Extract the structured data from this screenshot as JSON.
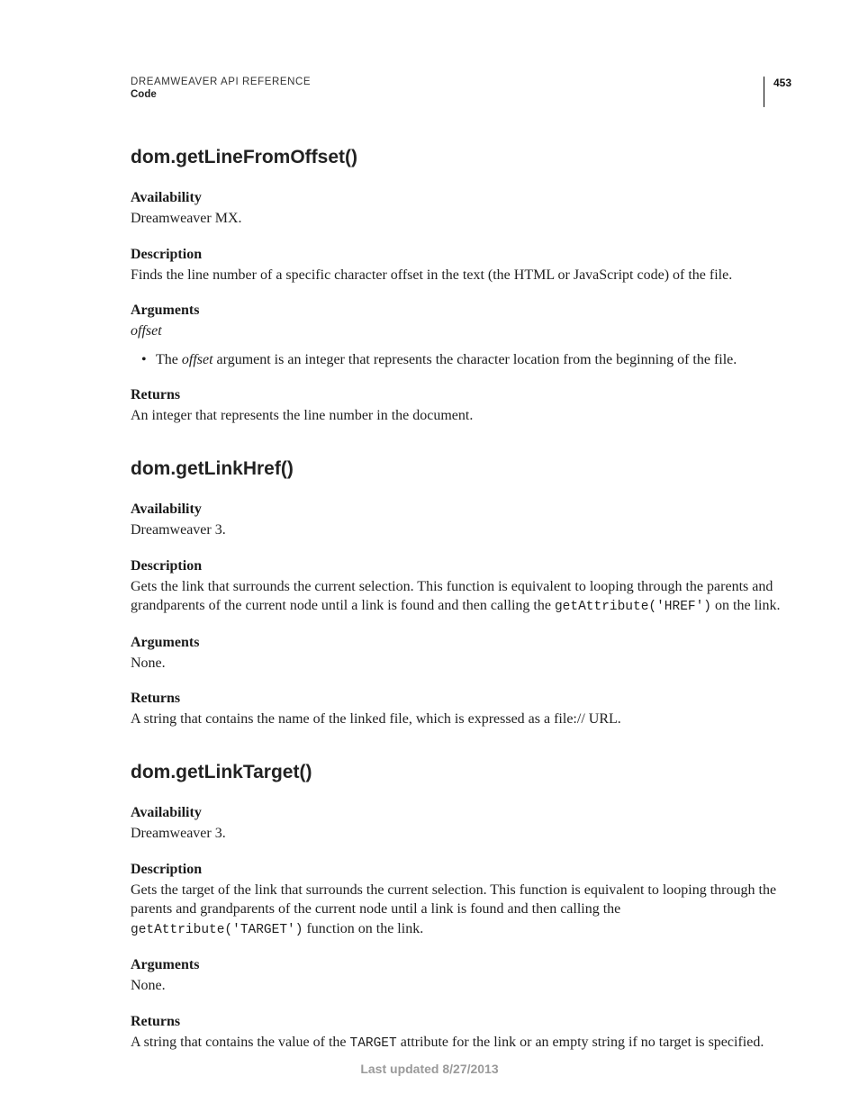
{
  "header": {
    "title": "DREAMWEAVER API REFERENCE",
    "section": "Code",
    "page_number": "453"
  },
  "functions": [
    {
      "name": "dom.getLineFromOffset()",
      "availability_label": "Availability",
      "availability_text": "Dreamweaver MX.",
      "description_label": "Description",
      "description_text": "Finds the line number of a specific character offset in the text (the HTML or JavaScript code) of the file.",
      "arguments_label": "Arguments",
      "arguments_signature": "offset",
      "arguments_bullets": [
        {
          "pre": "The ",
          "em": "offset",
          "post": " argument is an integer that represents the character location from the beginning of the file."
        }
      ],
      "returns_label": "Returns",
      "returns_text": "An integer that represents the line number in the document."
    },
    {
      "name": "dom.getLinkHref()",
      "availability_label": "Availability",
      "availability_text": "Dreamweaver 3.",
      "description_label": "Description",
      "description_pre": "Gets the link that surrounds the current selection. This function is equivalent to looping through the parents and grandparents of the current node until a link is found and then calling the ",
      "description_code": "getAttribute('HREF')",
      "description_post": " on the link.",
      "arguments_label": "Arguments",
      "arguments_text": "None.",
      "returns_label": "Returns",
      "returns_text": "A string that contains the name of the linked file, which is expressed as a file:// URL."
    },
    {
      "name": "dom.getLinkTarget()",
      "availability_label": "Availability",
      "availability_text": "Dreamweaver 3.",
      "description_label": "Description",
      "description_pre": "Gets the target of the link that surrounds the current selection. This function is equivalent to looping through the parents and grandparents of the current node until a link is found and then calling the ",
      "description_code": "getAttribute('TARGET')",
      "description_post": " function on the link.",
      "arguments_label": "Arguments",
      "arguments_text": "None.",
      "returns_label": "Returns",
      "returns_pre": "A string that contains the value of the ",
      "returns_code": "TARGET",
      "returns_post": " attribute for the link or an empty string if no target is specified."
    }
  ],
  "footer": {
    "text": "Last updated 8/27/2013"
  }
}
